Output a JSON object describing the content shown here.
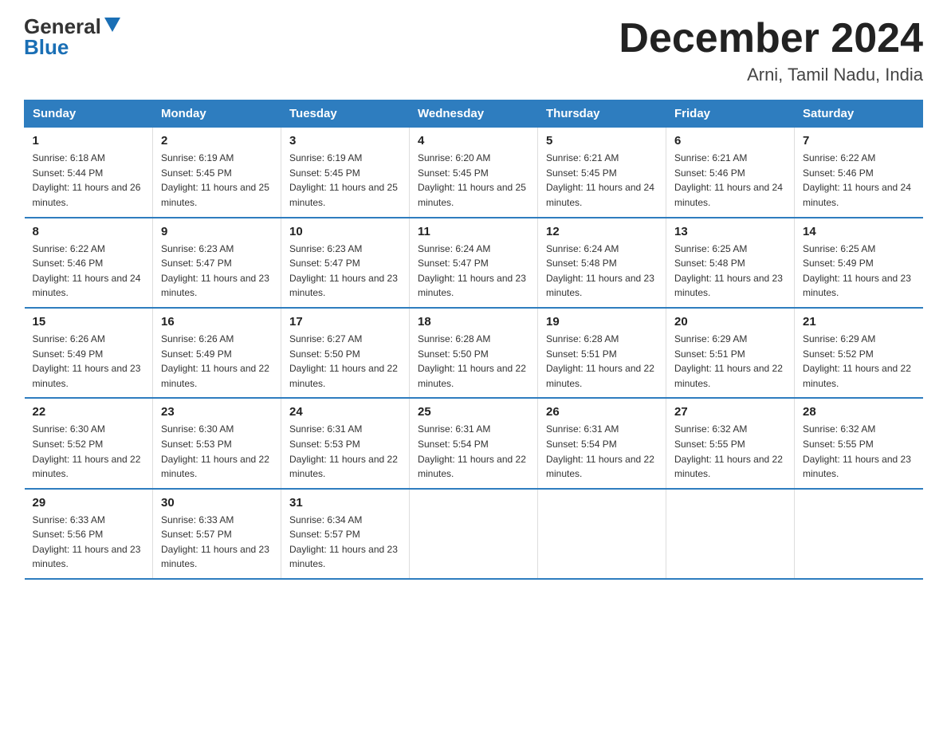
{
  "header": {
    "logo_general": "General",
    "logo_blue": "Blue",
    "month_title": "December 2024",
    "subtitle": "Arni, Tamil Nadu, India"
  },
  "days_of_week": [
    "Sunday",
    "Monday",
    "Tuesday",
    "Wednesday",
    "Thursday",
    "Friday",
    "Saturday"
  ],
  "weeks": [
    [
      {
        "day": "1",
        "sunrise": "6:18 AM",
        "sunset": "5:44 PM",
        "daylight": "11 hours and 26 minutes."
      },
      {
        "day": "2",
        "sunrise": "6:19 AM",
        "sunset": "5:45 PM",
        "daylight": "11 hours and 25 minutes."
      },
      {
        "day": "3",
        "sunrise": "6:19 AM",
        "sunset": "5:45 PM",
        "daylight": "11 hours and 25 minutes."
      },
      {
        "day": "4",
        "sunrise": "6:20 AM",
        "sunset": "5:45 PM",
        "daylight": "11 hours and 25 minutes."
      },
      {
        "day": "5",
        "sunrise": "6:21 AM",
        "sunset": "5:45 PM",
        "daylight": "11 hours and 24 minutes."
      },
      {
        "day": "6",
        "sunrise": "6:21 AM",
        "sunset": "5:46 PM",
        "daylight": "11 hours and 24 minutes."
      },
      {
        "day": "7",
        "sunrise": "6:22 AM",
        "sunset": "5:46 PM",
        "daylight": "11 hours and 24 minutes."
      }
    ],
    [
      {
        "day": "8",
        "sunrise": "6:22 AM",
        "sunset": "5:46 PM",
        "daylight": "11 hours and 24 minutes."
      },
      {
        "day": "9",
        "sunrise": "6:23 AM",
        "sunset": "5:47 PM",
        "daylight": "11 hours and 23 minutes."
      },
      {
        "day": "10",
        "sunrise": "6:23 AM",
        "sunset": "5:47 PM",
        "daylight": "11 hours and 23 minutes."
      },
      {
        "day": "11",
        "sunrise": "6:24 AM",
        "sunset": "5:47 PM",
        "daylight": "11 hours and 23 minutes."
      },
      {
        "day": "12",
        "sunrise": "6:24 AM",
        "sunset": "5:48 PM",
        "daylight": "11 hours and 23 minutes."
      },
      {
        "day": "13",
        "sunrise": "6:25 AM",
        "sunset": "5:48 PM",
        "daylight": "11 hours and 23 minutes."
      },
      {
        "day": "14",
        "sunrise": "6:25 AM",
        "sunset": "5:49 PM",
        "daylight": "11 hours and 23 minutes."
      }
    ],
    [
      {
        "day": "15",
        "sunrise": "6:26 AM",
        "sunset": "5:49 PM",
        "daylight": "11 hours and 23 minutes."
      },
      {
        "day": "16",
        "sunrise": "6:26 AM",
        "sunset": "5:49 PM",
        "daylight": "11 hours and 22 minutes."
      },
      {
        "day": "17",
        "sunrise": "6:27 AM",
        "sunset": "5:50 PM",
        "daylight": "11 hours and 22 minutes."
      },
      {
        "day": "18",
        "sunrise": "6:28 AM",
        "sunset": "5:50 PM",
        "daylight": "11 hours and 22 minutes."
      },
      {
        "day": "19",
        "sunrise": "6:28 AM",
        "sunset": "5:51 PM",
        "daylight": "11 hours and 22 minutes."
      },
      {
        "day": "20",
        "sunrise": "6:29 AM",
        "sunset": "5:51 PM",
        "daylight": "11 hours and 22 minutes."
      },
      {
        "day": "21",
        "sunrise": "6:29 AM",
        "sunset": "5:52 PM",
        "daylight": "11 hours and 22 minutes."
      }
    ],
    [
      {
        "day": "22",
        "sunrise": "6:30 AM",
        "sunset": "5:52 PM",
        "daylight": "11 hours and 22 minutes."
      },
      {
        "day": "23",
        "sunrise": "6:30 AM",
        "sunset": "5:53 PM",
        "daylight": "11 hours and 22 minutes."
      },
      {
        "day": "24",
        "sunrise": "6:31 AM",
        "sunset": "5:53 PM",
        "daylight": "11 hours and 22 minutes."
      },
      {
        "day": "25",
        "sunrise": "6:31 AM",
        "sunset": "5:54 PM",
        "daylight": "11 hours and 22 minutes."
      },
      {
        "day": "26",
        "sunrise": "6:31 AM",
        "sunset": "5:54 PM",
        "daylight": "11 hours and 22 minutes."
      },
      {
        "day": "27",
        "sunrise": "6:32 AM",
        "sunset": "5:55 PM",
        "daylight": "11 hours and 22 minutes."
      },
      {
        "day": "28",
        "sunrise": "6:32 AM",
        "sunset": "5:55 PM",
        "daylight": "11 hours and 23 minutes."
      }
    ],
    [
      {
        "day": "29",
        "sunrise": "6:33 AM",
        "sunset": "5:56 PM",
        "daylight": "11 hours and 23 minutes."
      },
      {
        "day": "30",
        "sunrise": "6:33 AM",
        "sunset": "5:57 PM",
        "daylight": "11 hours and 23 minutes."
      },
      {
        "day": "31",
        "sunrise": "6:34 AM",
        "sunset": "5:57 PM",
        "daylight": "11 hours and 23 minutes."
      },
      null,
      null,
      null,
      null
    ]
  ]
}
